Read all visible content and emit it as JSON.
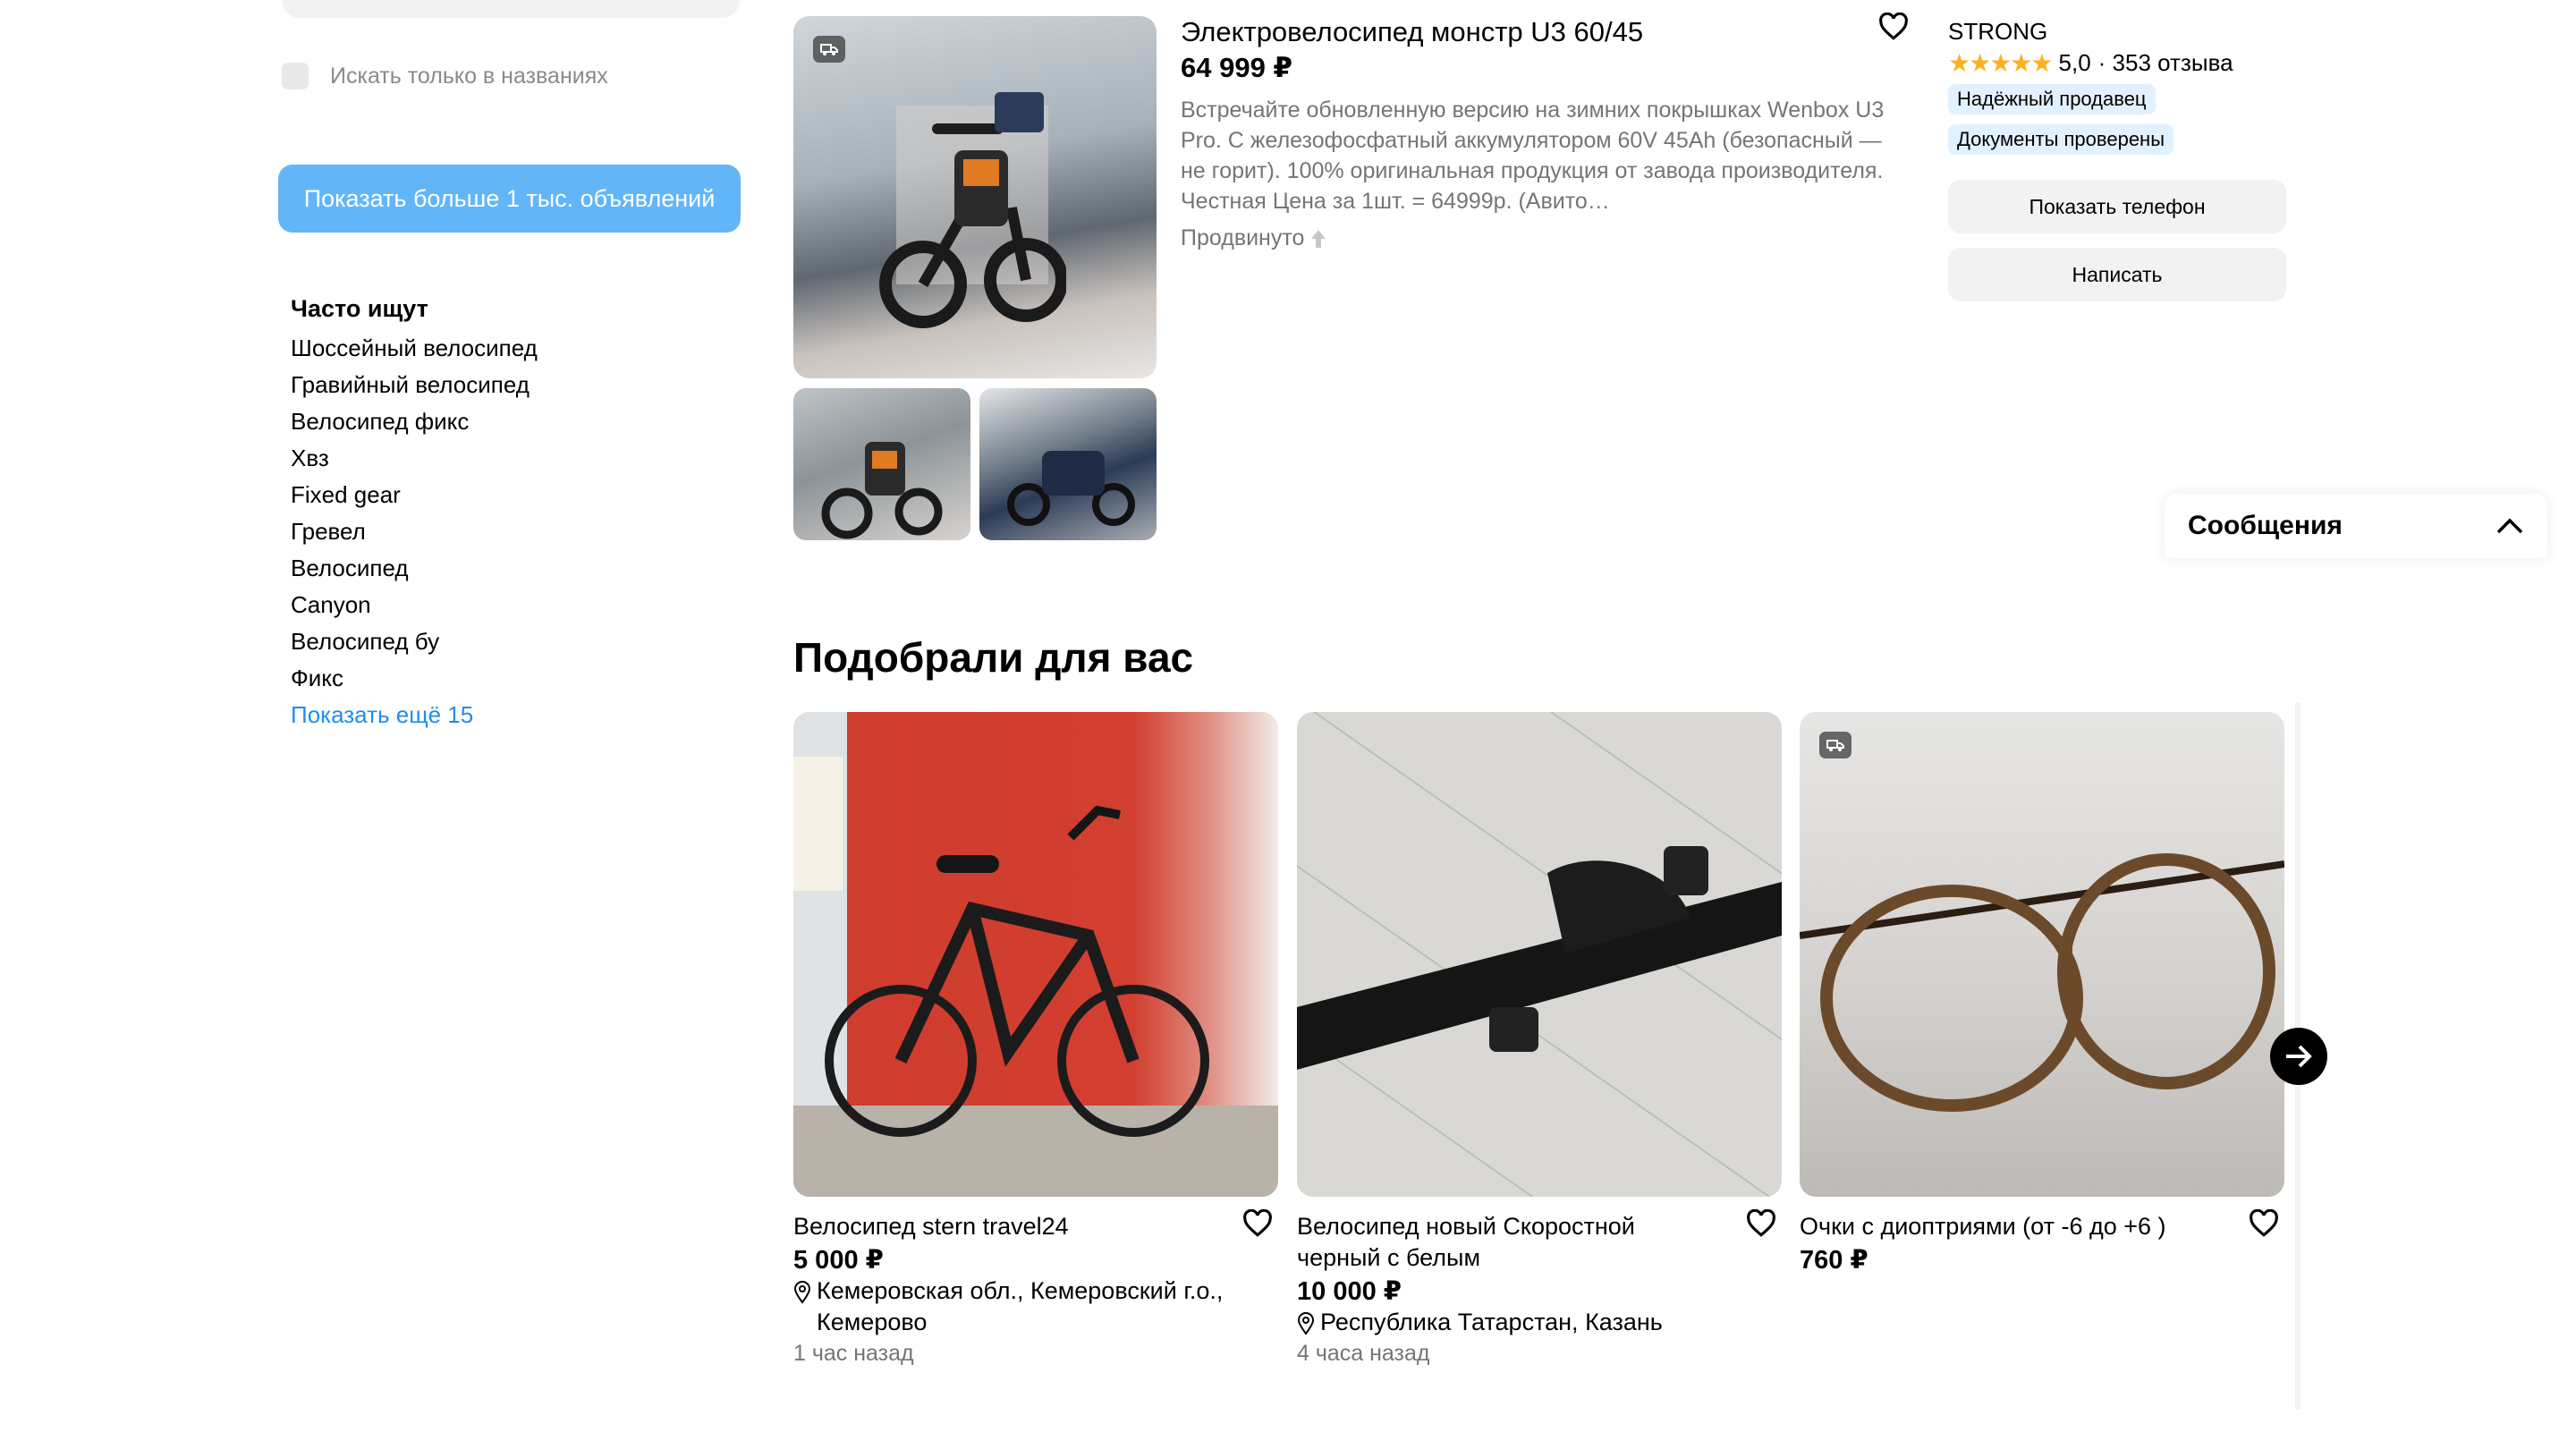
{
  "sidebar": {
    "only_titles_label": "Искать только в названиях",
    "show_more_button": "Показать больше 1 тыс. объявлений",
    "often_title": "Часто ищут",
    "often_links": [
      "Шоссейный велосипед",
      "Гравийный велосипед",
      "Велосипед фикс",
      "Хвз",
      "Fixed gear",
      "Гревел",
      "Велосипед",
      "Canyon",
      "Велосипед бу",
      "Фикс"
    ],
    "show_more_link": "Показать ещё 15"
  },
  "promoted_item": {
    "title": "Электровелосипед монстр U3 60/45",
    "price": "64 999 ₽",
    "description": "Встречайте обновленную версию на зимних покрышках Wenbox U3 Pro. С железофосфатный аккумулятором 60V 45Ah (безопасный — не горит). 100% оригинальная продукция от завода производителя. Чеcтная Цена за 1шт. = 64999р. (Авито…",
    "promoted_label": "Продвинуто",
    "seller": {
      "name": "STRONG",
      "rating": "5,0",
      "reviews": "· 353 отзыва",
      "badge_reliable": "Надёжный продавец",
      "badge_docs": "Документы проверены",
      "show_phone": "Показать телефон",
      "write": "Написать"
    }
  },
  "messages": {
    "title": "Сообщения"
  },
  "recommendations": {
    "title": "Подобрали для вас",
    "cards": [
      {
        "name": "Велосипед stern travel24",
        "price": "5 000 ₽",
        "location": "Кемеровская обл., Кемеровский г.о., Кемерово",
        "ago": "1 час назад"
      },
      {
        "name": "Велосипед новый Скоростной черный с белым",
        "price": "10 000 ₽",
        "location": "Республика Татарстан, Казань",
        "ago": "4 часа назад"
      },
      {
        "name": "Очки с диоптриями (от -6 до +6 )",
        "price": "760 ₽"
      }
    ]
  },
  "colors": {
    "accent": "#62b6f8",
    "link": "#1f8df0",
    "star": "#ffb021",
    "badge_bg": "#e2f1ff"
  },
  "icons": [
    "heart-outline-icon",
    "delivery-icon",
    "arrow-up-icon",
    "location-pin-icon",
    "chevron-up-icon",
    "arrow-right-icon",
    "star-icon"
  ]
}
